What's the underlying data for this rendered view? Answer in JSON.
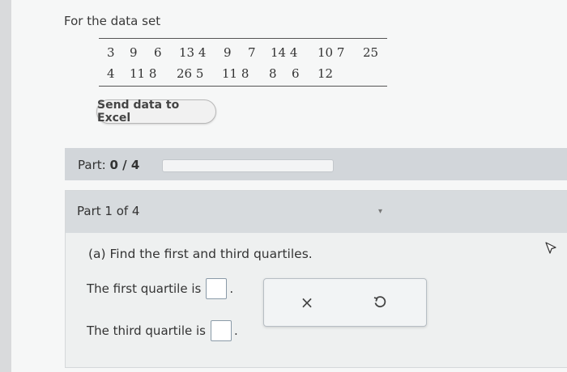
{
  "intro": "For the data set",
  "data_rows": [
    [
      "3",
      "9",
      "6",
      "13 4",
      "9",
      "7",
      "14 4",
      "10 7",
      "25"
    ],
    [
      "4",
      "11 8",
      "26 5",
      "11 8",
      "8",
      "6",
      "12"
    ]
  ],
  "excel_button": "Send data to Excel",
  "part_bar": {
    "label": "Part:",
    "progress": "0 / 4",
    "fraction": 0
  },
  "part_panel": {
    "title": "Part 1 of 4",
    "question": "(a) Find the first and third quartiles.",
    "first_quartile_label": "The first quartile is",
    "third_quartile_label": "The third quartile is",
    "period": ".",
    "first_quartile_value": "",
    "third_quartile_value": ""
  },
  "tools": {
    "clear_symbol": "×",
    "undo_icon": "undo-icon"
  },
  "colors": {
    "background": "#f6f7f7",
    "part_bar": "#d2d6da",
    "panel_head": "#d7dbde"
  }
}
